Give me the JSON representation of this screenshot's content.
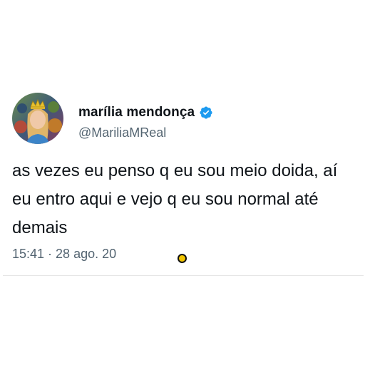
{
  "tweet": {
    "author_name": "marília mendonça",
    "author_handle": "@MariliaMReal",
    "text": "as vezes eu penso q eu sou meio doida, aí eu entro aqui e vejo q eu sou normal até demais",
    "timestamp": "15:41 · 28 ago. 20"
  },
  "icons": {
    "verified": "verified-badge-icon",
    "avatar": "profile-photo",
    "cursor": "cursor-indicator"
  },
  "colors": {
    "verified_blue": "#1d9bf0",
    "text_primary": "#0f1419",
    "text_secondary": "#536471",
    "cursor_fill": "#f2c500"
  }
}
